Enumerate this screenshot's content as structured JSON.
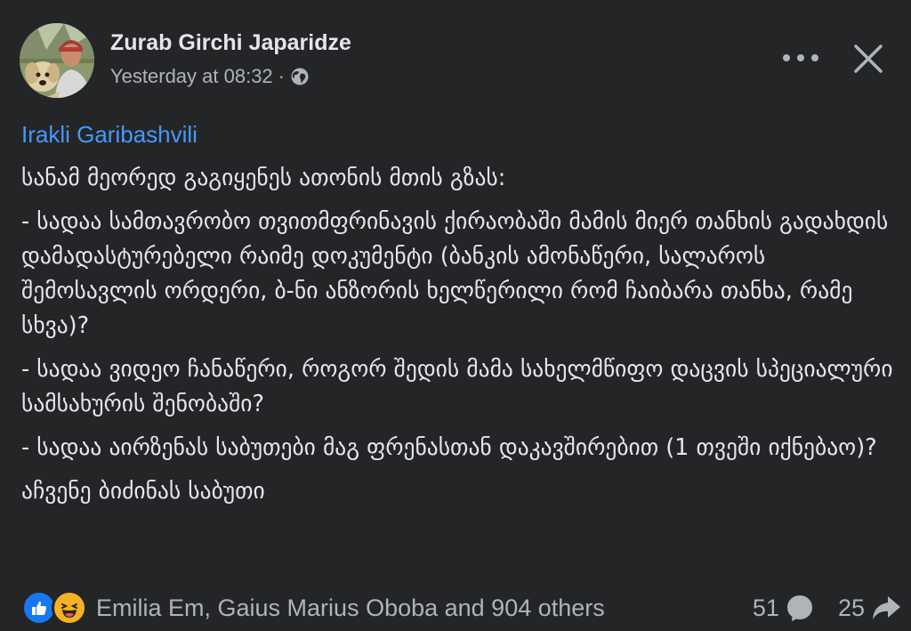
{
  "post": {
    "author": "Zurab Girchi Japaridze",
    "timestamp": "Yesterday at 08:32",
    "separator": "·",
    "privacy_icon": "globe-icon",
    "mention": "Irakli Garibashvili",
    "paragraphs": [
      "სანამ მეორედ გაგიყენეს ათონის მთის გზას:",
      "- სადაა სამთავრობო თვითმფრინავის ქირაობაში მამის მიერ თანხის გადახდის დამადასტურებელი რაიმე დოკუმენტი (ბანკის ამონაწერი, სალაროს შემოსავლის ორდერი, ბ-ნი ანზორის ხელწერილი რომ ჩაიბარა თანხა, რამე სხვა)?",
      "- სადაა ვიდეო ჩანაწერი, როგორ შედის მამა სახელმწიფო დაცვის სპეციალური სამსახურის შენობაში?",
      "- სადაა აირზენას საბუთები მაგ ფრენასთან დაკავშირებით (1 თვეში იქნებაო)?",
      "აჩვენე ბიძინას საბუთი"
    ]
  },
  "footer": {
    "reaction_icons": [
      "like-icon",
      "haha-icon"
    ],
    "reactors": "Emilia Em, Gaius Marius Oboba and 904 others",
    "comments_count": "51",
    "shares_count": "25"
  },
  "colors": {
    "background": "#242526",
    "text": "#e4e6eb",
    "secondary_text": "#b0b3b8",
    "link": "#4599ff",
    "like": "#1877f2",
    "haha": "#f7b125"
  }
}
